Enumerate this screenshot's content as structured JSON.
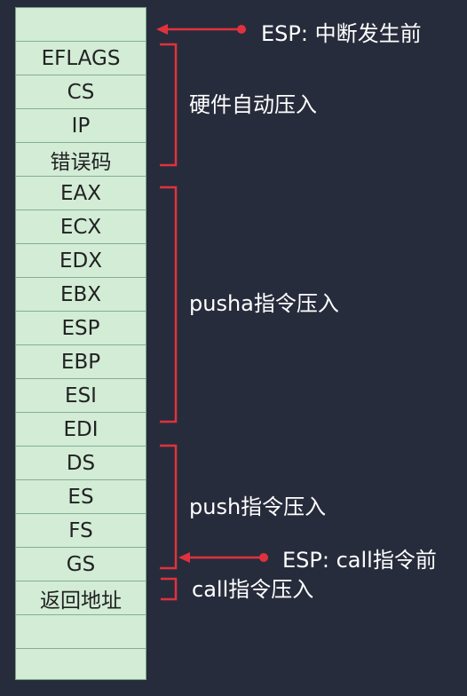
{
  "stack": {
    "top_empty": "",
    "cells": [
      "EFLAGS",
      "CS",
      "IP",
      "错误码",
      "EAX",
      "ECX",
      "EDX",
      "EBX",
      "ESP",
      "EBP",
      "ESI",
      "EDI",
      "DS",
      "ES",
      "FS",
      "GS",
      "返回地址"
    ],
    "bottom_empty": [
      "",
      ""
    ]
  },
  "pointers": {
    "esp_before_interrupt": "ESP: 中断发生前",
    "esp_before_call": "ESP: call指令前"
  },
  "groups": {
    "hardware": "硬件自动压入",
    "pusha": "pusha指令压入",
    "push": "push指令压入",
    "call": "call指令压入"
  },
  "colors": {
    "background": "#272c3c",
    "cell_fill": "#d2ecd6",
    "accent_red": "#e0323c"
  }
}
